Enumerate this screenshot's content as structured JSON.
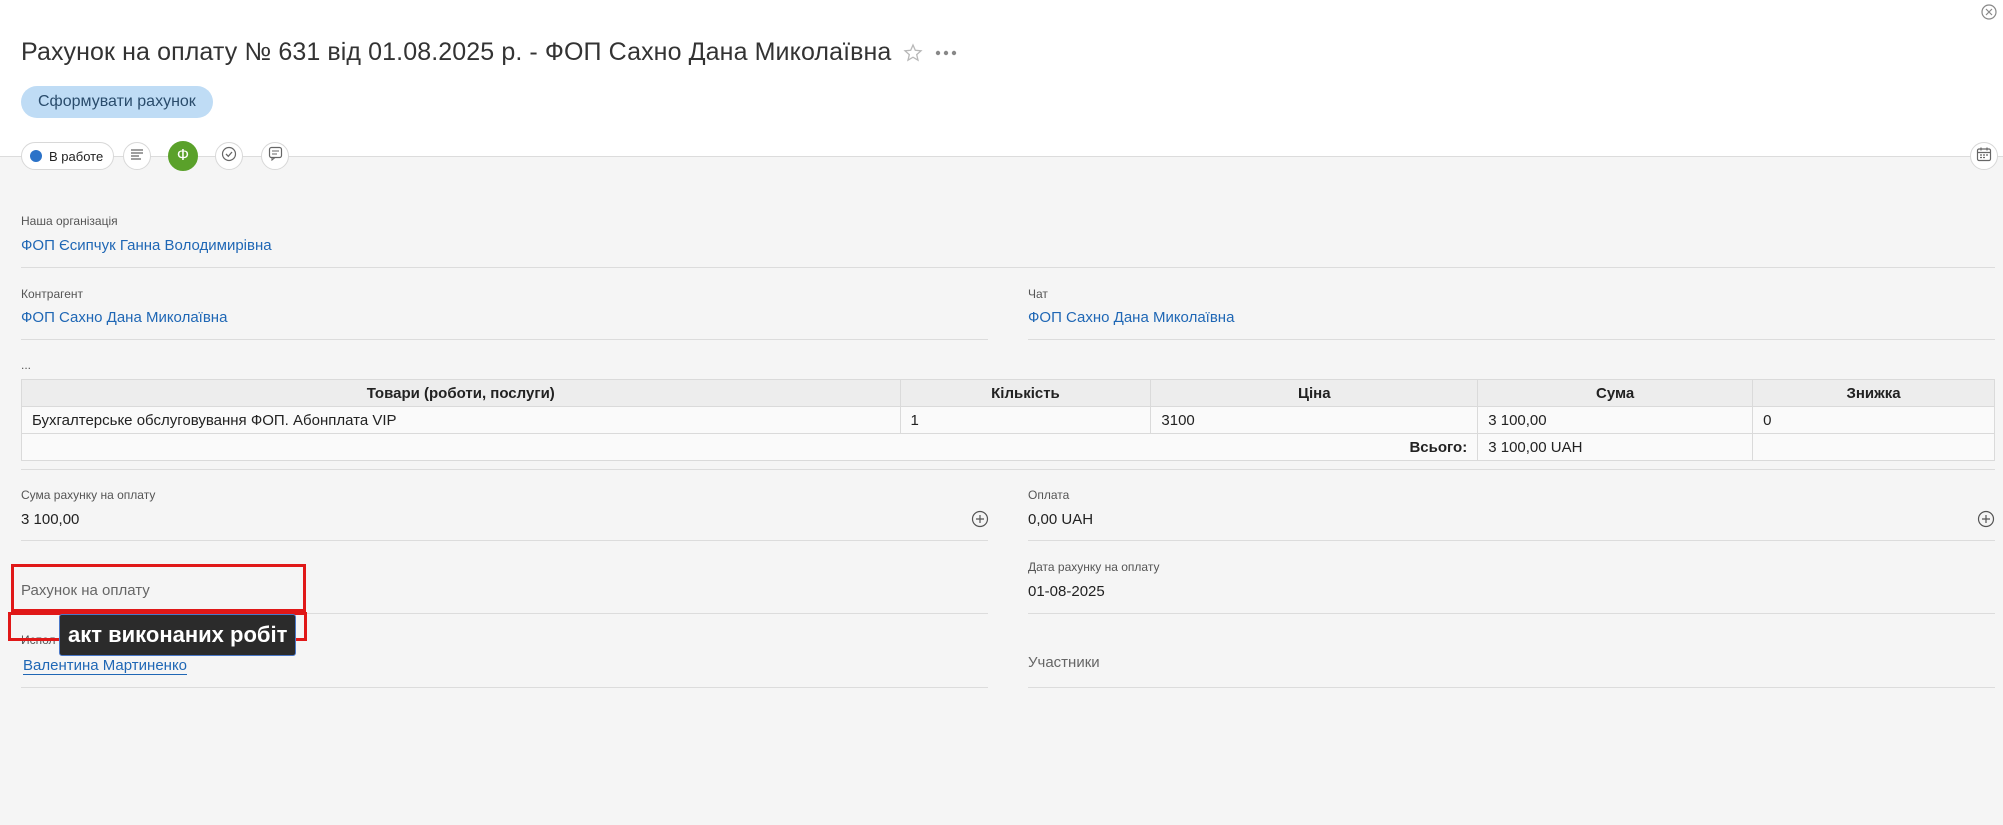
{
  "header": {
    "title": "Рахунок на оплату № 631 від 01.08.2025 р. - ФОП Сахно Дана Миколаївна",
    "primary_button": "Сформувати рахунок"
  },
  "toolbar": {
    "status_label": "В работе",
    "status_color": "#2b72c8",
    "accent_color": "#5aa12a",
    "green_button_glyph": "Ф",
    "icons": [
      "list-icon",
      "ф-icon",
      "check-circle-icon",
      "comment-icon",
      "calendar-icon"
    ]
  },
  "fields": {
    "our_org_label": "Наша організація",
    "our_org_value": "ФОП Єсипчук Ганна Володимирівна",
    "counterparty_label": "Контрагент",
    "counterparty_value": "ФОП Сахно Дана Миколаївна",
    "chat_label": "Чат",
    "chat_value": "ФОП Сахно Дана Миколаївна",
    "ellipsis": "...",
    "invoice_sum_label": "Сума рахунку на оплату",
    "invoice_sum_value": "3 100,00",
    "payment_label": "Оплата",
    "payment_value": "0,00 UAH",
    "invoice_placeholder": "Рахунок на оплату",
    "invoice_date_label": "Дата рахунку на оплату",
    "invoice_date_value": "01-08-2025",
    "executor_label_partial": "Испол",
    "executor_value": "Валентина Мартиненко",
    "participants_placeholder": "Участники"
  },
  "table": {
    "headers": [
      "Товари (роботи, послуги)",
      "Кількість",
      "Ціна",
      "Сума",
      "Знижка"
    ],
    "rows": [
      [
        "Бухгалтерське обслуговування ФОП. Абонплата VIP",
        "1",
        "3100",
        "3 100,00",
        "0"
      ]
    ],
    "total_label": "Всього:",
    "total_value": "3 100,00 UAH"
  },
  "tooltip": {
    "text": "акт виконаних робіт"
  }
}
